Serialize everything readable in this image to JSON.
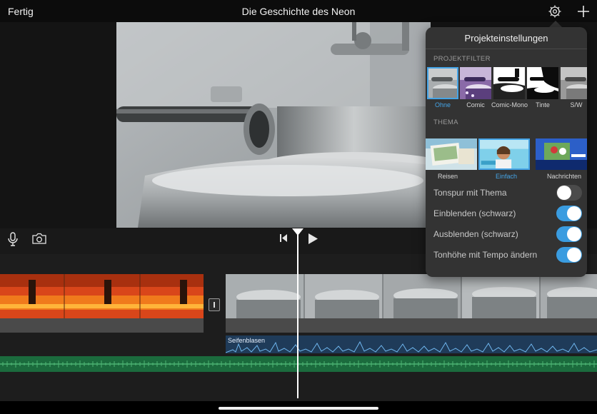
{
  "header": {
    "done_label": "Fertig",
    "title": "Die Geschichte des Neon"
  },
  "popover": {
    "title": "Projekteinstellungen",
    "filter_section": "PROJEKTFILTER",
    "filters": [
      {
        "label": "Ohne",
        "selected": true
      },
      {
        "label": "Comic",
        "selected": false
      },
      {
        "label": "Comic-Mono",
        "selected": false
      },
      {
        "label": "Tinte",
        "selected": false
      },
      {
        "label": "S/W",
        "selected": false
      }
    ],
    "theme_section": "THEMA",
    "themes": [
      {
        "label": "Reisen",
        "selected": false
      },
      {
        "label": "Einfach",
        "selected": true
      },
      {
        "label": "Nachrichten",
        "selected": false
      }
    ],
    "toggles": [
      {
        "label": "Tonspur mit Thema",
        "on": false
      },
      {
        "label": "Einblenden (schwarz)",
        "on": true
      },
      {
        "label": "Ausblenden (schwarz)",
        "on": true
      },
      {
        "label": "Tonhöhe mit Tempo ändern",
        "on": true
      }
    ]
  },
  "timeline": {
    "audio_clip_label": "Seifenblasen"
  },
  "icons": [
    "gear-icon",
    "plus-icon",
    "microphone-icon",
    "camera-icon",
    "skip-back-icon",
    "play-icon"
  ],
  "colors": {
    "accent": "#45a4e6",
    "toggle_on": "#3a9ce0",
    "music_track": "#1b6b3d",
    "audio_track": "#1f3b59"
  }
}
